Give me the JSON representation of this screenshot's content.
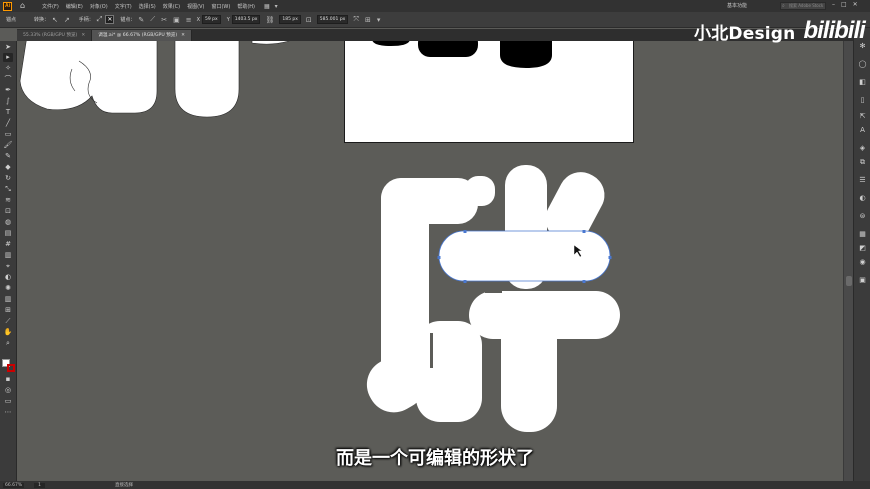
{
  "app": {
    "logo_text": "Ai"
  },
  "menu": {
    "items": [
      "文件(F)",
      "编辑(E)",
      "对象(O)",
      "文字(T)",
      "选择(S)",
      "效果(C)",
      "视图(V)",
      "窗口(W)",
      "帮助(H)"
    ],
    "workspace": "基本功能",
    "search_placeholder": "搜索 Adobe Stock"
  },
  "control": {
    "anchor_label": "锚点",
    "convert_label": "转换：",
    "handles_label": "手柄：",
    "anchors_label": "锚点：",
    "x_value": "59 px",
    "y_value": "1403.5 px",
    "w_value": "185 px",
    "h_value": "585.001 px"
  },
  "tabs": [
    {
      "label": "55.33% (RGB/GPU 预览)",
      "active": false
    },
    {
      "label": "调温.ai* @ 66.67% (RGB/GPU 预览)",
      "active": true
    }
  ],
  "status": {
    "zoom": "66.67%",
    "page": "1",
    "tool": "直接选择"
  },
  "watermark": {
    "text": "小北Design",
    "logo": "bilibili"
  },
  "subtitle": "而是一个可编辑的形状了",
  "colors": {
    "canvas": "#5c5c58",
    "shape_fill": "#ffffff",
    "selection": "#4a78d0",
    "stroke_swatch": "#cc0000"
  }
}
